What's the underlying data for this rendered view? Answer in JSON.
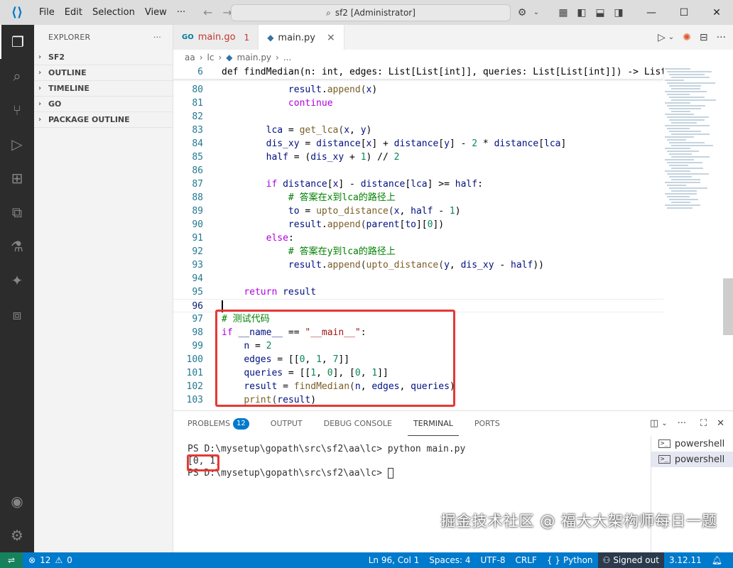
{
  "titlebar": {
    "menu": [
      "File",
      "Edit",
      "Selection",
      "View"
    ],
    "more": "···",
    "command_center": "sf2 [Administrator]"
  },
  "sidebar": {
    "header": "EXPLORER",
    "more": "···",
    "sections": [
      "SF2",
      "OUTLINE",
      "TIMELINE",
      "GO",
      "PACKAGE OUTLINE"
    ]
  },
  "tabs": [
    {
      "label": "main.go",
      "problems": "1",
      "icon": "go-icon"
    },
    {
      "label": "main.py",
      "icon": "python-icon",
      "close": "×"
    }
  ],
  "breadcrumb": [
    "aa",
    "lc",
    "main.py",
    "..."
  ],
  "editor": {
    "sticky_line": {
      "no": "6",
      "text": "def findMedian(n: int, edges: List[List[int]], queries: List[List[int]]) -> List"
    },
    "lines": [
      {
        "no": "80",
        "text": "            result.append(x)"
      },
      {
        "no": "81",
        "text": "            continue"
      },
      {
        "no": "82",
        "text": ""
      },
      {
        "no": "83",
        "text": "        lca = get_lca(x, y)"
      },
      {
        "no": "84",
        "text": "        dis_xy = distance[x] + distance[y] - 2 * distance[lca]"
      },
      {
        "no": "85",
        "text": "        half = (dis_xy + 1) // 2"
      },
      {
        "no": "86",
        "text": ""
      },
      {
        "no": "87",
        "text": "        if distance[x] - distance[lca] >= half:"
      },
      {
        "no": "88",
        "text": "            # 答案在x到lca的路径上"
      },
      {
        "no": "89",
        "text": "            to = upto_distance(x, half - 1)"
      },
      {
        "no": "90",
        "text": "            result.append(parent[to][0])"
      },
      {
        "no": "91",
        "text": "        else:"
      },
      {
        "no": "92",
        "text": "            # 答案在y到lca的路径上"
      },
      {
        "no": "93",
        "text": "            result.append(upto_distance(y, dis_xy - half))"
      },
      {
        "no": "94",
        "text": ""
      },
      {
        "no": "95",
        "text": "    return result"
      },
      {
        "no": "96",
        "text": ""
      },
      {
        "no": "97",
        "text": "# 测试代码"
      },
      {
        "no": "98",
        "text": "if __name__ == \"__main__\":"
      },
      {
        "no": "99",
        "text": "    n = 2"
      },
      {
        "no": "100",
        "text": "    edges = [[0, 1, 7]]"
      },
      {
        "no": "101",
        "text": "    queries = [[1, 0], [0, 1]]"
      },
      {
        "no": "102",
        "text": "    result = findMedian(n, edges, queries)"
      },
      {
        "no": "103",
        "text": "    print(result)"
      }
    ]
  },
  "panel": {
    "tabs": [
      {
        "label": "PROBLEMS",
        "badge": "12"
      },
      {
        "label": "OUTPUT"
      },
      {
        "label": "DEBUG CONSOLE"
      },
      {
        "label": "TERMINAL",
        "active": true
      },
      {
        "label": "PORTS"
      }
    ],
    "terminal_lines": [
      "PS D:\\mysetup\\gopath\\src\\sf2\\aa\\lc> python main.py",
      "[0, 1]",
      "PS D:\\mysetup\\gopath\\src\\sf2\\aa\\lc> "
    ],
    "terminals": [
      "powershell",
      "powershell"
    ]
  },
  "watermark": "掘金技术社区 @ 福大大架构师每日一题",
  "statusbar": {
    "errors": "12",
    "warnings": "0",
    "position": "Ln 96, Col 1",
    "spaces": "Spaces: 4",
    "encoding": "UTF-8",
    "eol": "CRLF",
    "language": "Python",
    "signed": "Signed out",
    "version": "3.12.11"
  },
  "colors": {
    "accent": "#007acc",
    "highlight_box": "#e53935",
    "activity_bar": "#2c2c2c"
  }
}
